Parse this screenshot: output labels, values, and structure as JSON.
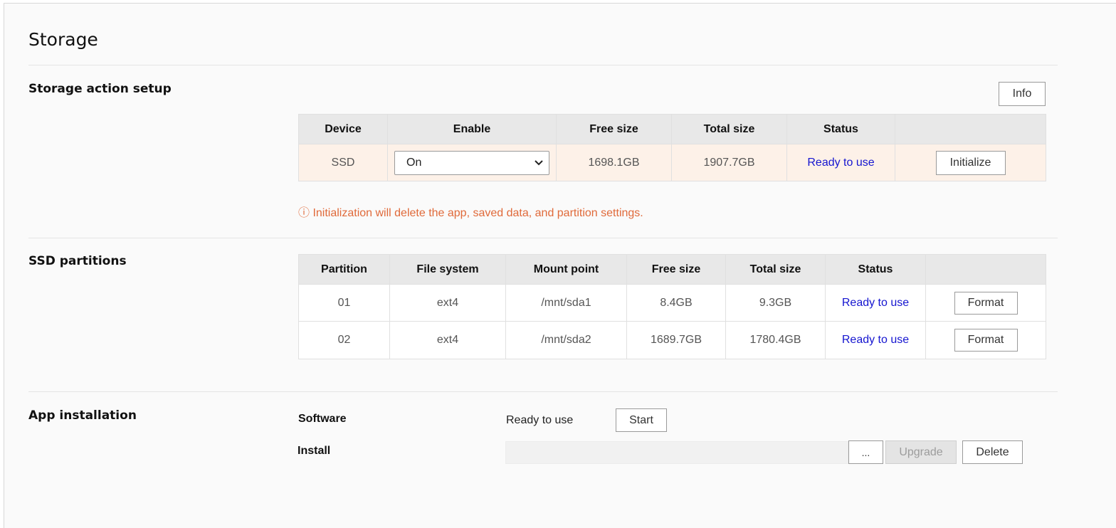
{
  "page": {
    "title": "Storage"
  },
  "storage_setup": {
    "title": "Storage action setup",
    "info_button": "Info",
    "columns": [
      "Device",
      "Enable",
      "Free size",
      "Total size",
      "Status",
      ""
    ],
    "row": {
      "device": "SSD",
      "enable_value": "On",
      "free_size": "1698.1GB",
      "total_size": "1907.7GB",
      "status": "Ready to use",
      "action": "Initialize"
    },
    "warning_icon": "info-circle-icon",
    "warning": "ⓘ Initialization will delete the app, saved data, and partition settings.",
    "warning_color": "#e06a3a",
    "highlight_color": "#fdf1e8"
  },
  "partitions": {
    "title": "SSD partitions",
    "columns": [
      "Partition",
      "File system",
      "Mount point",
      "Free size",
      "Total size",
      "Status",
      ""
    ],
    "rows": [
      {
        "partition": "01",
        "fs": "ext4",
        "mount": "/mnt/sda1",
        "free": "8.4GB",
        "total": "9.3GB",
        "status": "Ready to use",
        "action": "Format"
      },
      {
        "partition": "02",
        "fs": "ext4",
        "mount": "/mnt/sda2",
        "free": "1689.7GB",
        "total": "1780.4GB",
        "status": "Ready to use",
        "action": "Format"
      }
    ],
    "status_color": "#1515d0"
  },
  "app_install": {
    "title": "App installation",
    "software_label": "Software",
    "software_status": "Ready to use",
    "start_button": "Start",
    "install_label": "Install",
    "browse_button": "...",
    "upgrade_button": "Upgrade",
    "delete_button": "Delete"
  }
}
